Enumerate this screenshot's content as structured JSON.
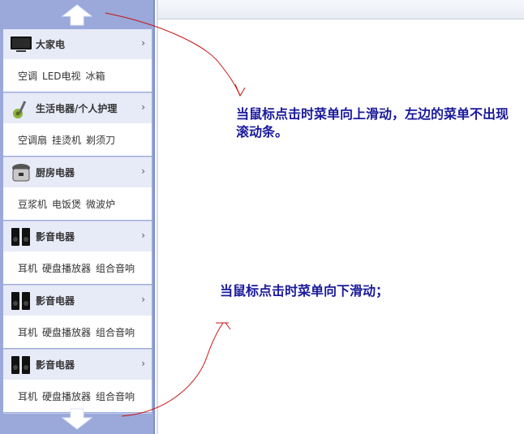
{
  "menu": {
    "up_arrow": "arrow-up-icon",
    "down_arrow": "arrow-down-icon",
    "categories": [
      {
        "title": "大家电",
        "icon": "tv-icon",
        "subs": [
          "空调",
          "LED电视",
          "冰箱"
        ]
      },
      {
        "title": "生活电器/个人护理",
        "icon": "vacuum-icon",
        "subs": [
          "空调扇",
          "挂烫机",
          "剃须刀"
        ]
      },
      {
        "title": "厨房电器",
        "icon": "rice-cooker-icon",
        "subs": [
          "豆浆机",
          "电饭煲",
          "微波炉"
        ]
      },
      {
        "title": "影音电器",
        "icon": "speaker-icon",
        "subs": [
          "耳机",
          "硬盘播放器",
          "组合音响"
        ]
      },
      {
        "title": "影音电器",
        "icon": "speaker-icon",
        "subs": [
          "耳机",
          "硬盘播放器",
          "组合音响"
        ]
      },
      {
        "title": "影音电器",
        "icon": "speaker-icon",
        "subs": [
          "耳机",
          "硬盘播放器",
          "组合音响"
        ]
      }
    ],
    "chevron": "›"
  },
  "notes": {
    "up": "当鼠标点击时菜单向上滑动，左边的菜单不出现滚动条。",
    "down": "当鼠标点击时菜单向下滑动；"
  },
  "colors": {
    "panel": "#9aa9da",
    "annotation_text": "#1a1a9c",
    "annotation_line": "#cc1111"
  }
}
